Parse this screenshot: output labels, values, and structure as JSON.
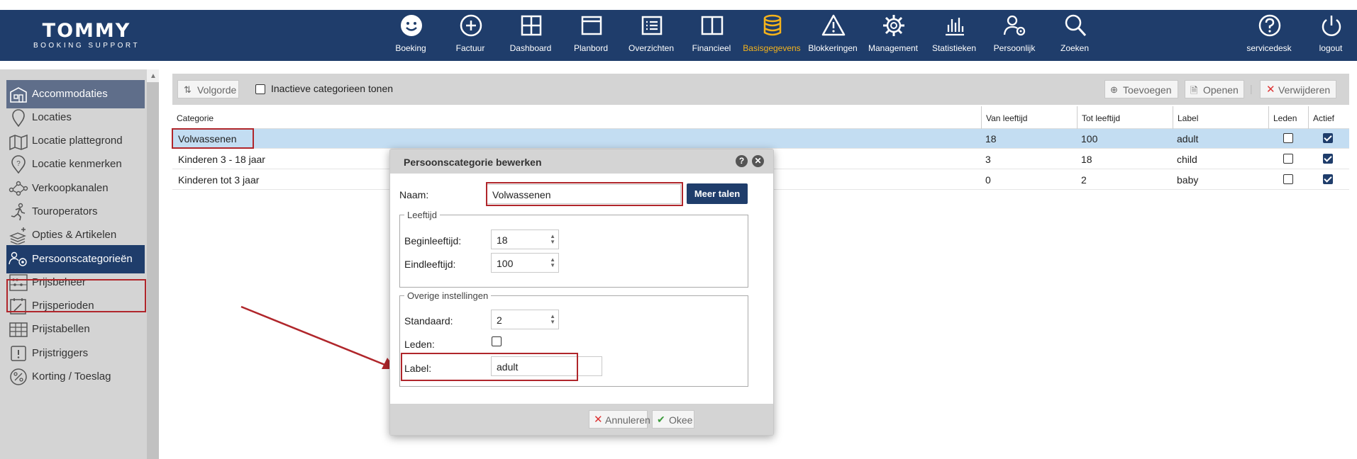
{
  "logo": {
    "line1": "TOMMY",
    "line2": "BOOKING SUPPORT"
  },
  "nav": [
    {
      "label": "Boeking",
      "icon": "smiley-icon"
    },
    {
      "label": "Factuur",
      "icon": "plus-circle-icon"
    },
    {
      "label": "Dashboard",
      "icon": "grid-icon"
    },
    {
      "label": "Planbord",
      "icon": "window-icon"
    },
    {
      "label": "Overzichten",
      "icon": "list-icon"
    },
    {
      "label": "Financieel",
      "icon": "book-icon"
    },
    {
      "label": "Basisgegevens",
      "icon": "database-icon",
      "active": true
    },
    {
      "label": "Blokkeringen",
      "icon": "warning-icon"
    },
    {
      "label": "Management",
      "icon": "gear-icon"
    },
    {
      "label": "Statistieken",
      "icon": "chart-icon"
    },
    {
      "label": "Persoonlijk",
      "icon": "user-gear-icon"
    },
    {
      "label": "Zoeken",
      "icon": "search-icon"
    },
    {
      "label": "servicedesk",
      "icon": "question-icon"
    },
    {
      "label": "logout",
      "icon": "power-icon"
    }
  ],
  "sidebar": {
    "items": [
      {
        "label": "Accommodaties",
        "icon": "building-icon",
        "state": "highlight"
      },
      {
        "label": "Locaties",
        "icon": "pin-icon"
      },
      {
        "label": "Locatie plattegrond",
        "icon": "map-icon"
      },
      {
        "label": "Locatie kenmerken",
        "icon": "pin-question-icon"
      },
      {
        "label": "Verkoopkanalen",
        "icon": "network-icon"
      },
      {
        "label": "Touroperators",
        "icon": "runner-icon"
      },
      {
        "label": "Opties & Artikelen",
        "icon": "layers-plus-icon"
      },
      {
        "label": "Persoonscategorieën",
        "icon": "people-gear-icon",
        "state": "selected"
      },
      {
        "label": "Prijsbeheer",
        "icon": "abacus-icon"
      },
      {
        "label": "Prijsperioden",
        "icon": "calendar-edit-icon"
      },
      {
        "label": "Prijstabellen",
        "icon": "table-icon"
      },
      {
        "label": "Prijstriggers",
        "icon": "exclamation-box-icon"
      },
      {
        "label": "Korting / Toeslag",
        "icon": "percent-icon"
      }
    ]
  },
  "toolbar": {
    "sort_label": "Volgorde",
    "inactive_label": "Inactieve categorieen tonen",
    "add_label": "Toevoegen",
    "open_label": "Openen",
    "delete_label": "Verwijderen"
  },
  "table": {
    "headers": {
      "categorie": "Categorie",
      "van": "Van leeftijd",
      "tot": "Tot leeftijd",
      "label": "Label",
      "leden": "Leden",
      "actief": "Actief"
    },
    "rows": [
      {
        "categorie": "Volwassenen",
        "van": "18",
        "tot": "100",
        "label": "adult",
        "leden": false,
        "actief": true
      },
      {
        "categorie": "Kinderen 3 - 18 jaar",
        "van": "3",
        "tot": "18",
        "label": "child",
        "leden": false,
        "actief": true
      },
      {
        "categorie": "Kinderen tot 3 jaar",
        "van": "0",
        "tot": "2",
        "label": "baby",
        "leden": false,
        "actief": true
      }
    ]
  },
  "dialog": {
    "title": "Persoonscategorie bewerken",
    "naam_label": "Naam:",
    "naam_value": "Volwassenen",
    "meer_talen": "Meer talen",
    "leeftijd_legend": "Leeftijd",
    "begin_label": "Beginleeftijd:",
    "begin_value": "18",
    "eind_label": "Eindleeftijd:",
    "eind_value": "100",
    "overige_legend": "Overige instellingen",
    "standaard_label": "Standaard:",
    "standaard_value": "2",
    "leden_label": "Leden:",
    "label_label": "Label:",
    "label_value": "adult",
    "cancel_label": "Annuleren",
    "ok_label": "Okee"
  },
  "colors": {
    "nav_bg": "#1f3d6b",
    "active": "#f5b31b",
    "highlight_box": "#b0262b",
    "selected_row": "#c3ddf2"
  }
}
